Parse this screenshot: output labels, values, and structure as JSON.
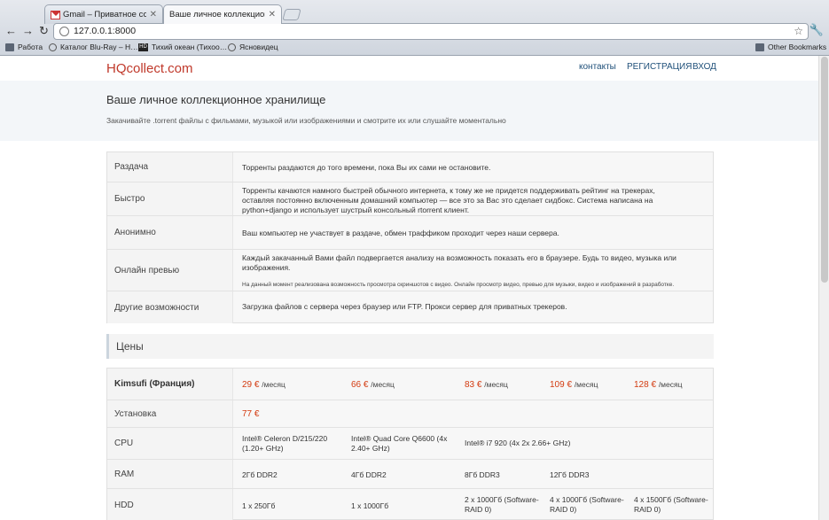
{
  "browser": {
    "tabs": [
      {
        "title": "Gmail – Приватное сообще…",
        "icon": "gmail-icon"
      },
      {
        "title": "Ваше личное коллекционное…",
        "icon": "page-icon"
      }
    ],
    "url": "127.0.0.1:8000",
    "bookmarks": [
      {
        "label": "Работа",
        "icon": "folder-icon"
      },
      {
        "label": "Каталог Blu-Ray – H…",
        "icon": "globe-icon"
      },
      {
        "label": "Тихий океан (Тихоо…",
        "icon": "hd-icon"
      },
      {
        "label": "Ясновидец",
        "icon": "globe-icon"
      }
    ],
    "other_bookmarks": "Other Bookmarks"
  },
  "site": {
    "logo": "HQcollect.com",
    "nav": [
      "контакты",
      "РЕГИСТРАЦИЯ",
      "ВХОД"
    ],
    "hero_title": "Ваше личное коллекционное хранилище",
    "hero_subtitle": "Закачивайте .torrent файлы с фильмами, музыкой или изображениями и смотрите их или слушайте моментально"
  },
  "features": [
    {
      "label": "Раздача",
      "text": "Торренты раздаются до того времени, пока Вы их сами не остановите."
    },
    {
      "label": "Быстро",
      "text": "Торренты качаются намного быстрей обычного интернета, к тому же не придется поддерживать рейтинг на трекерах, оставляя постоянно включенным домашний компьютер — все это за Вас это сделает сидбокс. Система написана на python+django и использует шустрый консольный rtorrent клиент."
    },
    {
      "label": "Анонимно",
      "text": "Ваш компьютер не участвует в раздаче, обмен траффиком проходит через наши сервера."
    },
    {
      "label": "Онлайн превью",
      "text": "Каждый закачанный Вами файл подвергается анализу на возможность показать его в браузере. Будь то видео, музыка или изображения.",
      "note": "На данный момент реализована возможность просмотра скриншотов с видео. Онлайн просмотр видео, превью для музыки, видео и изображений в разработке."
    },
    {
      "label": "Другие возможности",
      "text": "Загрузка файлов с сервера через браузер или FTP. Прокси сервер для приватных трекеров."
    }
  ],
  "prices_title": "Цены",
  "pricing": {
    "plan_label": "Kimsufi (Франция)",
    "per": "/месяц",
    "prices": [
      "29 €",
      "66 €",
      "83 €",
      "109 €",
      "128 €"
    ],
    "setup_label": "Установка",
    "setup_price": "77 €",
    "cpu_label": "CPU",
    "cpu": [
      "Intel® Celeron D/215/220 (1.20+ GHz)",
      "Intel® Quad Core Q6600 (4x 2.40+ GHz)",
      "Intel® i7 920 (4x 2x 2.66+ GHz)"
    ],
    "ram_label": "RAM",
    "ram": [
      "2Гб DDR2",
      "4Гб DDR2",
      "8Гб DDR3",
      "12Гб DDR3"
    ],
    "hdd_label": "HDD",
    "hdd": [
      "1 x 250Гб",
      "1 x 1000Гб",
      "2 x 1000Гб (Software-RAID 0)",
      "4 x 1000Гб (Software-RAID 0)",
      "4 x 1500Гб (Software-RAID 0)"
    ]
  }
}
